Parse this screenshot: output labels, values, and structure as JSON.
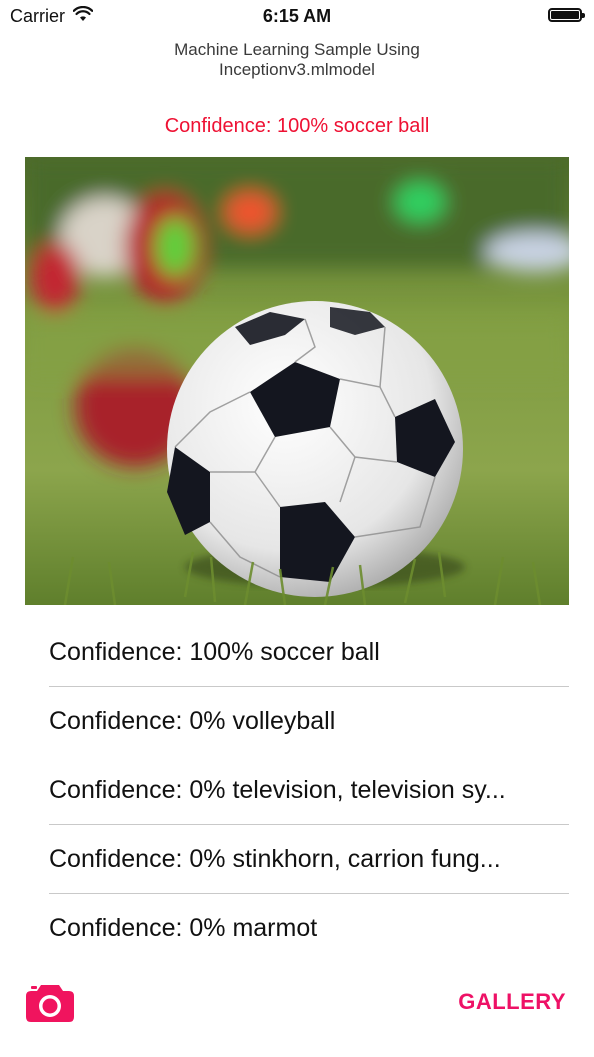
{
  "status_bar": {
    "carrier": "Carrier",
    "time": "6:15 AM",
    "wifi_icon": "wifi-icon",
    "battery_icon": "battery-icon"
  },
  "header": {
    "title_line1": "Machine Learning Sample Using",
    "title_line2": "Inceptionv3.mlmodel",
    "top_result": "Confidence: 100% soccer ball"
  },
  "photo": {
    "subject": "soccer ball on grass"
  },
  "results": [
    "Confidence: 100% soccer ball",
    "Confidence: 0% volleyball",
    "Confidence: 0% television, television sy...",
    "Confidence: 0% stinkhorn, carrion fung...",
    "Confidence: 0% marmot"
  ],
  "toolbar": {
    "camera_icon": "camera-icon",
    "gallery_label": "GALLERY"
  },
  "colors": {
    "accent": "#ee1166",
    "top_result": "#ee1133"
  }
}
